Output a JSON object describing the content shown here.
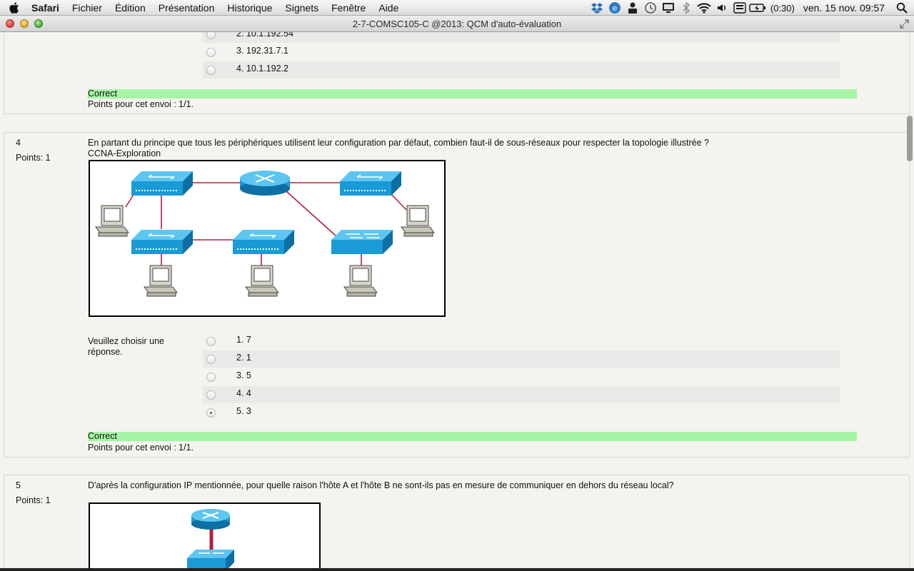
{
  "menubar": {
    "app": "Safari",
    "items": [
      "Fichier",
      "Édition",
      "Présentation",
      "Historique",
      "Signets",
      "Fenêtre",
      "Aide"
    ],
    "battery_text": "(0:30)",
    "clock": "ven. 15 nov.  09:57"
  },
  "window": {
    "title": "2-7-COMSC105-C @2013: QCM d'auto-évaluation"
  },
  "question3": {
    "options": [
      "2. 10.1.192.54",
      "3. 192.31.7.1",
      "4. 10.1.192.2"
    ],
    "feedback": "Correct",
    "score": "Points pour cet envoi : 1/1."
  },
  "question4": {
    "number": "4",
    "points": "Points: 1",
    "text": "En partant du principe que tous les périphériques utilisent leur configuration par défaut, combien faut-il de sous-réseaux pour respecter la topologie illustrée ?",
    "subtext": "CCNA-Exploration",
    "prompt": "Veuillez choisir une réponse.",
    "options": [
      "1. 7",
      "2. 1",
      "3. 5",
      "4. 4",
      "5. 3"
    ],
    "selected_index": 4,
    "feedback": "Correct",
    "score": "Points pour cet envoi : 1/1."
  },
  "question5": {
    "number": "5",
    "points": "Points: 1",
    "text": "D'après la configuration IP mentionnée, pour quelle raison l'hôte A et l'hôte B ne sont-ils pas en mesure de communiquer en dehors du réseau local?"
  },
  "colors": {
    "feedback_bg": "#a6f5a6",
    "device_blue": "#1a9ad6",
    "link_red": "#b0203a"
  }
}
